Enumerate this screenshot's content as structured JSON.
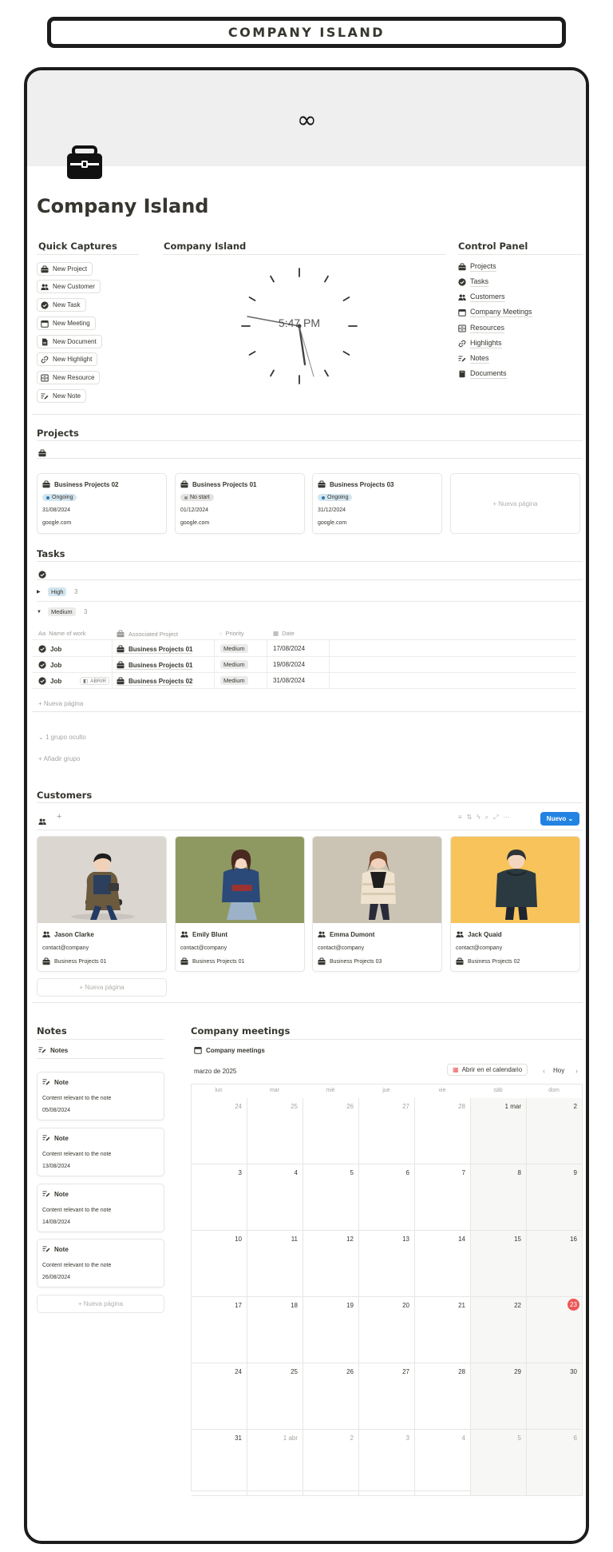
{
  "banner": {
    "title": "COMPANY ISLAND"
  },
  "page": {
    "title": "Company Island"
  },
  "quick_captures": {
    "heading": "Quick Captures",
    "buttons": [
      {
        "label": "New Project",
        "icon": "briefcase-icon"
      },
      {
        "label": "New Customer",
        "icon": "people-icon"
      },
      {
        "label": "New Task",
        "icon": "check-circle-icon"
      },
      {
        "label": "New Meeting",
        "icon": "calendar-icon"
      },
      {
        "label": "New Document",
        "icon": "document-icon"
      },
      {
        "label": "New Highlight",
        "icon": "link-icon"
      },
      {
        "label": "New Resource",
        "icon": "archive-icon"
      },
      {
        "label": "New Note",
        "icon": "note-icon"
      }
    ]
  },
  "clock_section": {
    "heading": "Company Island",
    "time": "5:47 PM"
  },
  "control_panel": {
    "heading": "Control Panel",
    "items": [
      {
        "label": "Projects",
        "icon": "briefcase-icon"
      },
      {
        "label": "Tasks",
        "icon": "check-circle-icon"
      },
      {
        "label": "Customers",
        "icon": "people-icon"
      },
      {
        "label": "Company Meetings",
        "icon": "calendar-icon"
      },
      {
        "label": "Resources",
        "icon": "archive-icon"
      },
      {
        "label": "Highlights",
        "icon": "link-icon"
      },
      {
        "label": "Notes",
        "icon": "note-icon"
      },
      {
        "label": "Documents",
        "icon": "book-icon"
      }
    ]
  },
  "projects": {
    "heading": "Projects",
    "cards": [
      {
        "title": "Business Projects 02",
        "status": "Ongoing",
        "date": "31/08/2024",
        "url": "google.com"
      },
      {
        "title": "Business Projects 01",
        "status": "No start",
        "date": "01/12/2024",
        "url": "google.com"
      },
      {
        "title": "Business Projects 03",
        "status": "Ongoing",
        "date": "31/12/2024",
        "url": "google.com"
      }
    ],
    "new_page": "+ Nueva página"
  },
  "tasks": {
    "heading": "Tasks",
    "groups": [
      {
        "label": "High",
        "count": "3"
      },
      {
        "label": "Medium",
        "count": "3"
      }
    ],
    "columns": [
      "Name of work",
      "Associated Project",
      "Priority",
      "Date"
    ],
    "rows": [
      {
        "name": "Job",
        "project": "Business Projects 01",
        "priority": "Medium",
        "date": "17/08/2024"
      },
      {
        "name": "Job",
        "project": "Business Projects 01",
        "priority": "Medium",
        "date": "19/08/2024"
      },
      {
        "name": "Job",
        "project": "Business Projects 02",
        "priority": "Medium",
        "date": "31/08/2024",
        "open": "ABRIR"
      }
    ],
    "new_page": "+ Nueva página",
    "hidden_groups": "1 grupo oculto",
    "add_group": "+ Añadir grupo"
  },
  "customers": {
    "heading": "Customers",
    "new_button": "Nuevo",
    "cards": [
      {
        "name": "Jason Clarke",
        "email": "contact@company",
        "project": "Business Projects 01",
        "bg": "#dbd6cf"
      },
      {
        "name": "Emily Blunt",
        "email": "contact@company",
        "project": "Business Projects 01",
        "bg": "#8e9962"
      },
      {
        "name": "Emma Dumont",
        "email": "contact@company",
        "project": "Business Projects 03",
        "bg": "#cbc3b4"
      },
      {
        "name": "Jack Quaid",
        "email": "contact@company",
        "project": "Business Projects 02",
        "bg": "#f8c35a"
      }
    ],
    "new_page": "+ Nueva página"
  },
  "notes": {
    "heading": "Notes",
    "view_label": "Notes",
    "cards": [
      {
        "title": "Note",
        "content": "Content relevant to the note",
        "date": "05/08/2024"
      },
      {
        "title": "Note",
        "content": "Content relevant to the note",
        "date": "13/08/2024"
      },
      {
        "title": "Note",
        "content": "Content relevant to the note",
        "date": "14/08/2024"
      },
      {
        "title": "Note",
        "content": "Content relevant to the note",
        "date": "26/08/2024"
      }
    ],
    "new_page": "+ Nueva página"
  },
  "meetings": {
    "heading": "Company meetings",
    "view_label": "Company meetings",
    "month": "marzo de 2025",
    "open_calendar": "Abrir en el calendario",
    "today": "Hoy",
    "weekdays": [
      "lun",
      "mar",
      "mié",
      "jue",
      "vie",
      "sáb",
      "dom"
    ],
    "weeks": [
      [
        "24",
        "25",
        "26",
        "27",
        "28",
        "1 mar",
        "2"
      ],
      [
        "3",
        "4",
        "5",
        "6",
        "7",
        "8",
        "9"
      ],
      [
        "10",
        "11",
        "12",
        "13",
        "14",
        "15",
        "16"
      ],
      [
        "17",
        "18",
        "19",
        "20",
        "21",
        "22",
        "23"
      ],
      [
        "24",
        "25",
        "26",
        "27",
        "28",
        "29",
        "30"
      ],
      [
        "31",
        "1 abr",
        "2",
        "3",
        "4",
        "5",
        "6"
      ]
    ],
    "today_date": "23"
  },
  "colors": {
    "accent": "#2383e2",
    "today": "#eb5757",
    "ongoing_bg": "#d3e5ef",
    "ongoing_dot": "#2e78b0",
    "nostart_bg": "#e3e2e0"
  }
}
